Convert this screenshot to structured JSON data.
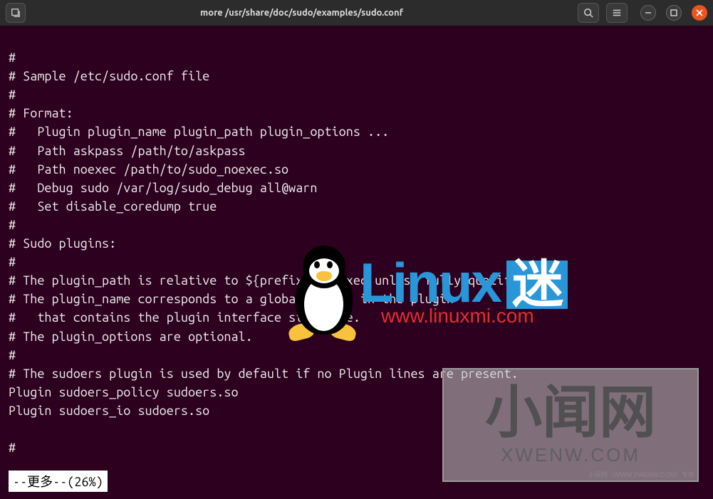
{
  "window": {
    "title": "more /usr/share/doc/sudo/examples/sudo.conf"
  },
  "terminal": {
    "lines": [
      "#",
      "# Sample /etc/sudo.conf file",
      "#",
      "# Format:",
      "#   Plugin plugin_name plugin_path plugin_options ...",
      "#   Path askpass /path/to/askpass",
      "#   Path noexec /path/to/sudo_noexec.so",
      "#   Debug sudo /var/log/sudo_debug all@warn",
      "#   Set disable_coredump true",
      "#",
      "# Sudo plugins:",
      "#",
      "# The plugin_path is relative to ${prefix}/libexec unless fully qualified.",
      "# The plugin_name corresponds to a global symbol in the plugin",
      "#   that contains the plugin interface structure.",
      "# The plugin_options are optional.",
      "#",
      "# The sudoers plugin is used by default if no Plugin lines are present.",
      "Plugin sudoers_policy sudoers.so",
      "Plugin sudoers_io sudoers.so",
      "",
      "#"
    ],
    "status": "--更多--(26%)"
  },
  "watermark1": {
    "word": "Linux",
    "suffix": "迷",
    "url": "www.linuxmi.com"
  },
  "watermark2": {
    "cn": "小闻网",
    "en": "XWENW.COM",
    "small": "小闻网（WWW.XWENW.COM）专用"
  }
}
